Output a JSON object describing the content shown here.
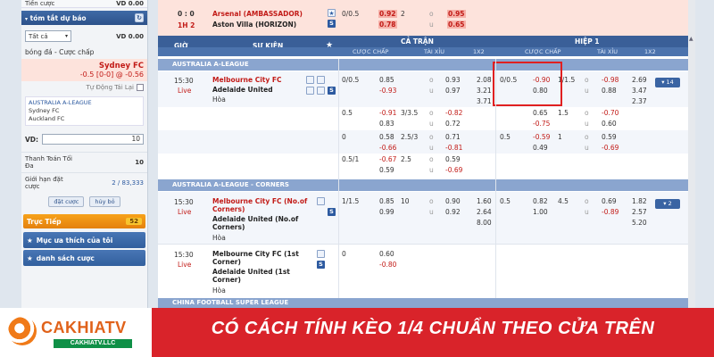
{
  "left_panel": {
    "balance_label": "Tiền cược",
    "balance_value": "VD 0.00",
    "summary_title": "tóm tắt dự báo",
    "filter_select": "Tất cả",
    "filter_amount": "VD 0.00",
    "bet_type": "bóng đá - Cược chấp",
    "bet_team": "Sydney FC",
    "bet_odds": "-0.5 [0-0] @ -0.56",
    "auto_accept": "Tự Động Tái Lại",
    "league": "AUSTRALIA A-LEAGUE",
    "home": "Sydney FC",
    "away": "Auckland FC",
    "vd_label": "VD:",
    "vd_value": "10",
    "payout_label": "Thanh Toán Tối Đa",
    "payout_value": "10",
    "limit_label": "Giới hạn đặt cược",
    "limit_value": "2 / 83,333",
    "place_bet": "đặt cược",
    "cancel": "hủy bỏ",
    "live_label": "Trực Tiếp",
    "live_count": "52",
    "favorites": "Mục ưa thích của tôi",
    "bet_list": "danh sách cược"
  },
  "header": {
    "time": "GIỜ",
    "event": "SỰ KIỆN",
    "full_match": "CẢ TRẬN",
    "half1": "HIỆP 1",
    "handicap": "CƯỢC CHẤP",
    "overunder": "TÀI XỈU",
    "x12": "1X2"
  },
  "top_match": {
    "score": "0 : 0",
    "period": "1H 2",
    "home": "Arsenal (AMBASSADOR)",
    "away": "Aston Villa (HORIZON)",
    "hdp": "0/0.5",
    "home_odds": "0.92",
    "away_odds": "0.78",
    "ou": "2",
    "ou_o": "o",
    "ou_u": "u",
    "over": "0.95",
    "under": "0.65"
  },
  "league1": {
    "name": "AUSTRALIA A-LEAGUE",
    "match": {
      "time": "15:30",
      "status": "Live",
      "home": "Melbourne City FC",
      "away": "Adelaide United",
      "draw": "Hòa",
      "more": "▾ 14"
    },
    "lines": [
      {
        "hdp": "0/0.5",
        "h": "0.85",
        "a": "-0.93",
        "ou": "",
        "o": "0.93",
        "u": "0.97",
        "x1": "2.08",
        "x2": "3.21",
        "x3": "3.71",
        "h1hdp": "0/0.5",
        "h1h": "-0.90",
        "h1a": "0.80",
        "h1ou": "1/1.5",
        "h1o": "-0.98",
        "h1u": "0.88",
        "h1x1": "2.69",
        "h1x2": "3.47",
        "h1x3": "2.37"
      },
      {
        "hdp": "0.5",
        "h": "-0.91",
        "a": "0.83",
        "ou": "3/3.5",
        "o": "-0.82",
        "u": "0.72",
        "x1": "",
        "x2": "",
        "x3": "",
        "h1hdp": "",
        "h1h": "0.65",
        "h1a": "-0.75",
        "h1ou": "1.5",
        "h1o": "-0.70",
        "h1u": "0.60",
        "h1x1": "",
        "h1x2": "",
        "h1x3": ""
      },
      {
        "hdp": "0",
        "h": "0.58",
        "a": "-0.66",
        "ou": "2.5/3",
        "o": "0.71",
        "u": "-0.81",
        "x1": "",
        "x2": "",
        "x3": "",
        "h1hdp": "0.5",
        "h1h": "-0.59",
        "h1a": "0.49",
        "h1ou": "1",
        "h1o": "0.59",
        "h1u": "-0.69",
        "h1x1": "",
        "h1x2": "",
        "h1x3": ""
      },
      {
        "hdp": "0.5/1",
        "h": "-0.67",
        "a": "0.59",
        "ou": "2.5",
        "o": "0.59",
        "u": "-0.69",
        "x1": "",
        "x2": "",
        "x3": "",
        "h1hdp": "",
        "h1h": "",
        "h1a": "",
        "h1ou": "",
        "h1o": "",
        "h1u": "",
        "h1x1": "",
        "h1x2": "",
        "h1x3": ""
      }
    ]
  },
  "league2": {
    "name": "AUSTRALIA A-LEAGUE - CORNERS",
    "m1": {
      "time": "15:30",
      "status": "Live",
      "home": "Melbourne City FC (No.of Corners)",
      "away": "Adelaide United (No.of Corners)",
      "draw": "Hòa",
      "hdp": "1/1.5",
      "h": "0.85",
      "a": "0.99",
      "ou": "10",
      "o": "0.90",
      "u": "0.92",
      "x1": "1.60",
      "x2": "2.64",
      "x3": "8.00",
      "h1hdp": "0.5",
      "h1h": "0.82",
      "h1a": "1.00",
      "h1ou": "4.5",
      "h1o": "0.69",
      "h1u": "-0.89",
      "h1x1": "1.82",
      "h1x2": "2.57",
      "h1x3": "5.20",
      "more": "▾ 2"
    },
    "m2": {
      "time": "15:30",
      "status": "Live",
      "home": "Melbourne City FC (1st Corner)",
      "away": "Adelaide United (1st Corner)",
      "draw": "Hòa",
      "hdp": "0",
      "h": "0.60",
      "a": "-0.80"
    }
  },
  "league3": {
    "name": "CHINA FOOTBALL SUPER LEAGUE"
  },
  "banner": {
    "logo": "CAKHIATV",
    "logo_url": "CAKHIATV.LLC",
    "headline": "CÓ CÁCH TÍNH KÈO 1/4 CHUẨN THEO CỬA TRÊN"
  }
}
